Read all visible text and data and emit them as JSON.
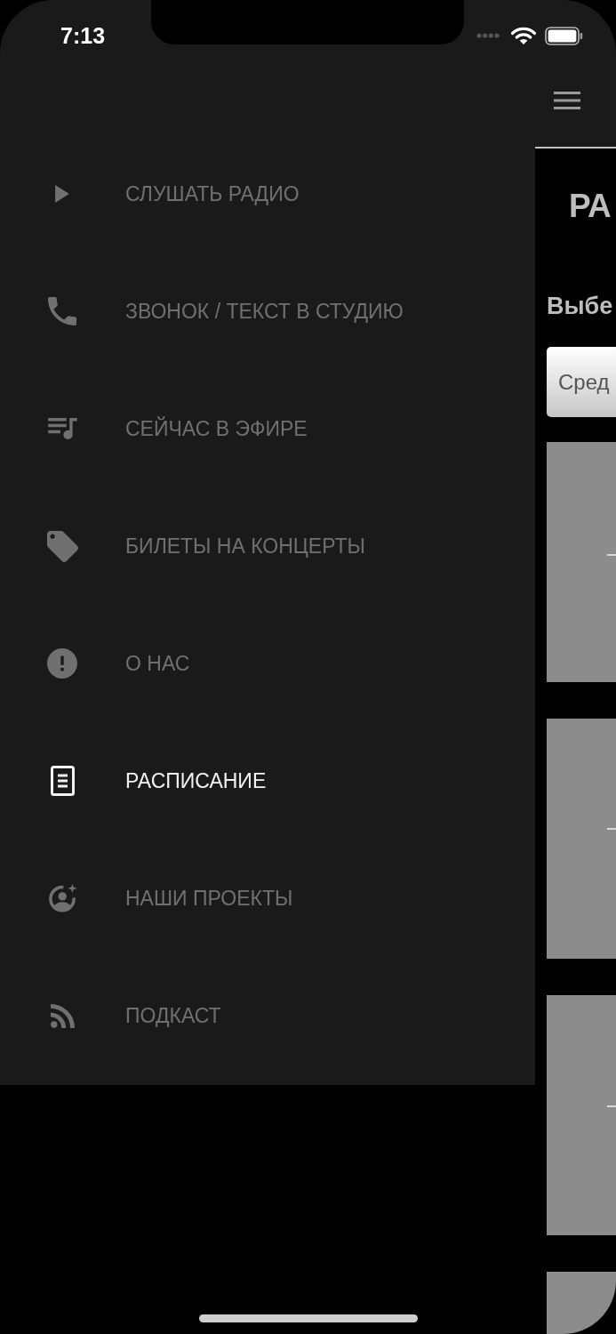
{
  "status_bar": {
    "time": "7:13"
  },
  "drawer": {
    "items": [
      {
        "label": "СЛУШАТЬ РАДИО",
        "selected": false
      },
      {
        "label": "ЗВОНОК / ТЕКСТ В СТУДИЮ",
        "selected": false
      },
      {
        "label": "СЕЙЧАС В ЭФИРЕ",
        "selected": false
      },
      {
        "label": "БИЛЕТЫ НА КОНЦЕРТЫ",
        "selected": false
      },
      {
        "label": "О НАС",
        "selected": false
      },
      {
        "label": "РАСПИСАНИЕ",
        "selected": true
      },
      {
        "label": "НАШИ ПРОЕКТЫ",
        "selected": false
      },
      {
        "label": "ПОДКАСТ",
        "selected": false
      }
    ]
  },
  "content": {
    "title": "РА",
    "prompt": "Выбе",
    "day_select": {
      "value": "Сред"
    }
  }
}
